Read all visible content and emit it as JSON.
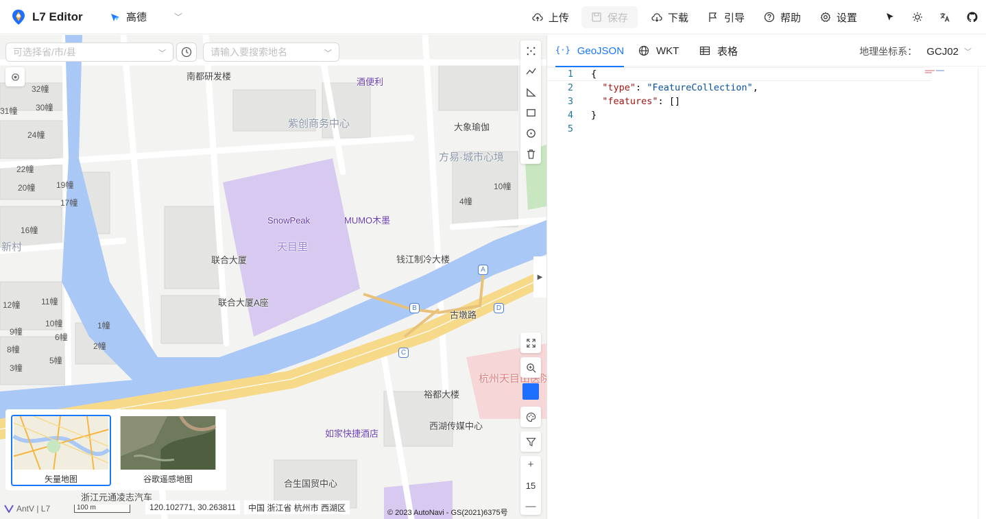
{
  "header": {
    "app_title": "L7 Editor",
    "map_provider": "高德",
    "buttons": {
      "upload": "上传",
      "save": "保存",
      "download": "下载",
      "guide": "引导",
      "help": "帮助",
      "settings": "设置"
    }
  },
  "map": {
    "region_placeholder": "可选择省/市/县",
    "search_placeholder": "请输入要搜索地名",
    "zoom_level": "15",
    "coordinates": "120.102771, 30.263811",
    "location": "中国 浙江省 杭州市 西湖区",
    "attribution": "© 2023 AutoNavi - GS(2021)6375号",
    "scale_label": "100 m",
    "antv_label": "AntV | L7",
    "basemaps": [
      {
        "label": "矢量地图",
        "active": true
      },
      {
        "label": "谷歌遥感地图",
        "active": false
      }
    ],
    "pois": [
      {
        "name": "南都研发楼"
      },
      {
        "name": "酒便利"
      },
      {
        "name": "紫创商务中心"
      },
      {
        "name": "大象瑜伽"
      },
      {
        "name": "方易·城市心境"
      },
      {
        "name": "SnowPeak"
      },
      {
        "name": "MUMO木墨"
      },
      {
        "name": "天目里"
      },
      {
        "name": "联合大厦"
      },
      {
        "name": "钱江制冷大楼"
      },
      {
        "name": "联合大厦A座"
      },
      {
        "name": "古墩路"
      },
      {
        "name": "裕都大楼"
      },
      {
        "name": "杭州天目山医院"
      },
      {
        "name": "西湖传媒中心"
      },
      {
        "name": "如家快捷酒店"
      },
      {
        "name": "合生国贸中心"
      },
      {
        "name": "新村"
      },
      {
        "name": "浙江元通凌志汽车"
      }
    ],
    "buildings": [
      "32幢",
      "30幢",
      "31幢",
      "24幢",
      "22幢",
      "20幢",
      "19幢",
      "17幢",
      "16幢",
      "12幢",
      "11幢",
      "10幢",
      "9幢",
      "8幢",
      "6幢",
      "5幢",
      "3幢",
      "2幢",
      "1幢",
      "4幢",
      "10幢"
    ],
    "metro_exits": [
      "A",
      "B",
      "C",
      "D"
    ],
    "draw_color": "#1e6fff"
  },
  "panel": {
    "tabs": [
      {
        "label": "GeoJSON",
        "active": true
      },
      {
        "label": "WKT",
        "active": false
      },
      {
        "label": "表格",
        "active": false
      }
    ],
    "crs_label": "地理坐标系：",
    "crs_value": "GCJ02",
    "code_lines": [
      {
        "n": "1",
        "text": "{"
      },
      {
        "n": "2",
        "key": "\"type\"",
        "sep": ": ",
        "val": "\"FeatureCollection\"",
        "end": ","
      },
      {
        "n": "3",
        "key": "\"features\"",
        "sep": ": ",
        "val": "[]",
        "end": ""
      },
      {
        "n": "4",
        "text": "}"
      },
      {
        "n": "5",
        "text": ""
      }
    ]
  },
  "colors": {
    "accent": "#1677ff",
    "water": "#a9c8f5",
    "plaza": "#d7c9f0",
    "road_major": "#f7d98a"
  }
}
